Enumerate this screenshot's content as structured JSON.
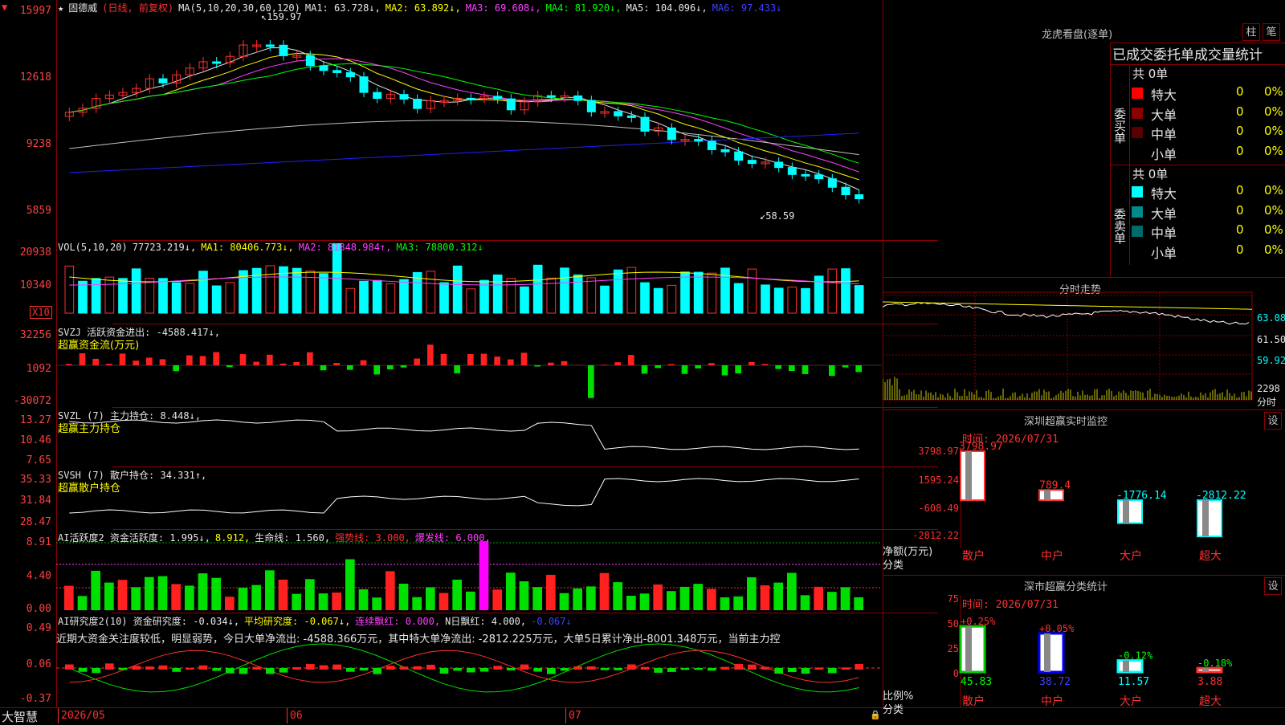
{
  "app": {
    "brand": "大智慧"
  },
  "kline": {
    "stock_name": "固德威",
    "period": "(日线, 前复权)",
    "ma_label": "MA(5,10,20,30,60,120)",
    "ma": [
      {
        "label": "MA1: 63.728↓,",
        "color": "#e6e6e6"
      },
      {
        "label": "MA2: 63.892↓,",
        "color": "#ffff00"
      },
      {
        "label": "MA3: 69.608↓,",
        "color": "#ff40ff"
      },
      {
        "label": "MA4: 81.920↓,",
        "color": "#00ff00"
      },
      {
        "label": "MA5: 104.096↓,",
        "color": "#e6e6e6"
      },
      {
        "label": "MA6: 97.433↓",
        "color": "#4040ff"
      }
    ],
    "y_ticks": [
      "15997",
      "12618",
      "9238",
      "5859"
    ],
    "high_label": "159.97",
    "low_label": "58.59"
  },
  "vol": {
    "title": "VOL(5,10,20)",
    "value": "77723.219↓,",
    "ma": [
      {
        "label": "MA1: 80406.773↓,",
        "color": "#ffff00"
      },
      {
        "label": "MA2: 81848.984↑,",
        "color": "#ff40ff"
      },
      {
        "label": "MA3: 78800.312↓",
        "color": "#00ff00"
      }
    ],
    "y_ticks": [
      "20938",
      "10340"
    ],
    "unit": "X10"
  },
  "svzj": {
    "title": "SVZJ  活跃资金进出: -4588.417↓,",
    "subtitle": "超赢资金流(万元)",
    "y_ticks": [
      "32256",
      "1092",
      "-30072"
    ]
  },
  "svzl": {
    "title": "SVZL (7) 主力持仓: 8.448↓,",
    "subtitle": "超赢主力持仓",
    "y_ticks": [
      "13.27",
      "10.46",
      "7.65"
    ]
  },
  "svsh": {
    "title": "SVSH (7) 散户持仓: 34.331↑,",
    "subtitle": "超赢散户持仓",
    "y_ticks": [
      "35.33",
      "31.84",
      "28.47"
    ]
  },
  "ai_active": {
    "title": "AI活跃度2 资金活跃度: 1.995↓,",
    "v2": "8.912,",
    "life": "生命线: 1.560,",
    "strong": "强势线: 3.000,",
    "burst": "爆发线: 6.000,",
    "y_ticks": [
      "8.91",
      "4.40",
      "0.00"
    ]
  },
  "ai_research": {
    "title": "AI研究度2(10) 资金研究度: -0.034↓,",
    "avg": "平均研究度: -0.067↓,",
    "consec": "连续飘红: 0.000,",
    "nday": "N日飘红: 4.000,",
    "last": "-0.067↓",
    "desc": "近期大资金关注度较低，明显弱势，今日大单净流出: -4588.366万元，其中特大单净流出: -2812.225万元，大单5日累计净出-8001.348万元，当前主力控",
    "y_ticks": [
      "0.49",
      "0.06",
      "-0.37"
    ]
  },
  "x_axis": [
    "2026/05",
    "06",
    "07"
  ],
  "dragon": {
    "title": "龙虎看盘(逐单)",
    "btn_zhu": "柱",
    "btn_bi": "笔",
    "header": "已成交委托单成交量统计",
    "buy_label": "委买单",
    "sell_label": "委卖单",
    "buy_total": "共 0单",
    "sell_total": "共 0单",
    "buy_rows": [
      {
        "name": "特大",
        "count": "0",
        "pct": "0%",
        "color": "#ff0000"
      },
      {
        "name": "大单",
        "count": "0",
        "pct": "0%",
        "color": "#8b0000"
      },
      {
        "name": "中单",
        "count": "0",
        "pct": "0%",
        "color": "#5a0000"
      },
      {
        "name": "小单",
        "count": "0",
        "pct": "0%",
        "color": ""
      }
    ],
    "sell_rows": [
      {
        "name": "特大",
        "count": "0",
        "pct": "0%",
        "color": "#00ffff"
      },
      {
        "name": "大单",
        "count": "0",
        "pct": "0%",
        "color": "#008b8b"
      },
      {
        "name": "中单",
        "count": "0",
        "pct": "0%",
        "color": "#006b6b"
      },
      {
        "name": "小单",
        "count": "0",
        "pct": "0%",
        "color": ""
      }
    ]
  },
  "intraday": {
    "title": "分时走势",
    "price_ticks": [
      "63.08",
      "61.50",
      "59.92"
    ],
    "vol_ticks": [
      "2298",
      "分时"
    ]
  },
  "sz_monitor": {
    "title": "深圳超赢实时监控",
    "btn": "设",
    "time": "时间: 2026/07/31",
    "y_ticks": [
      "3798.97",
      "1595.24",
      "-608.49",
      "-2812.22"
    ],
    "axis_note": "净额(万元)",
    "cat_label": "分类",
    "categories": [
      "散户",
      "中户",
      "大户",
      "超大"
    ],
    "values": [
      3798.97,
      789.4,
      -1776.14,
      -2812.22
    ],
    "value_labels": [
      "3798.97",
      "789.4",
      "-1776.14",
      "-2812.22"
    ]
  },
  "sz_class": {
    "title": "深市超赢分类统计",
    "btn": "设",
    "time": "时间: 2026/07/31",
    "y_ticks": [
      "75",
      "50",
      "25",
      "0"
    ],
    "axis_note": "比例%",
    "cat_label": "分类",
    "categories": [
      "散户",
      "中户",
      "大户",
      "超大"
    ],
    "values": [
      45.83,
      38.72,
      11.57,
      3.88
    ],
    "changes": [
      "+0.25%",
      "+0.05%",
      "-0.12%",
      "-0.18%"
    ],
    "value_labels": [
      "45.83",
      "38.72",
      "11.57",
      "3.88"
    ]
  },
  "colors": {
    "up": "#ff3030",
    "down": "#00ffff",
    "grid": "#8b0000"
  }
}
